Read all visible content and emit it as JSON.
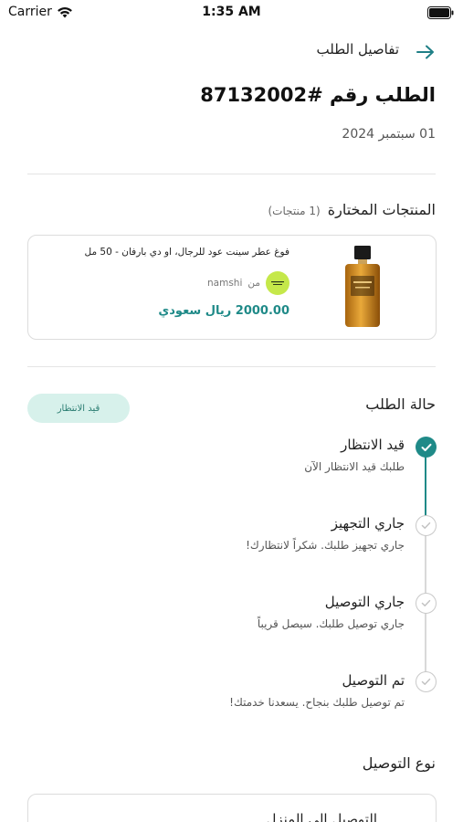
{
  "status_bar": {
    "carrier": "Carrier",
    "time": "1:35 AM"
  },
  "header": {
    "title": "تفاصيل الطلب",
    "back_icon": "arrow-right-icon"
  },
  "order": {
    "title": "الطلب رقم #87132002",
    "date": "01 سبتمبر 2024"
  },
  "products_section": {
    "title": "المنتجات المختارة",
    "count_label": "(1 منتجات)",
    "items": [
      {
        "name": "فوغ عطر سينت عود للرجال، او دي بارفان - 50 مل",
        "seller_from": "من",
        "seller_name": "namshi",
        "price": "2000.00 ريال سعودي"
      }
    ]
  },
  "status_section": {
    "title": "حالة الطلب",
    "badge": "قيد الانتظار",
    "steps": [
      {
        "title": "قيد الانتظار",
        "desc": "طلبك قيد الانتظار الآن",
        "state": "done"
      },
      {
        "title": "جاري التجهيز",
        "desc": "جاري تجهيز طلبك. شكراً لانتظارك!",
        "state": "todo"
      },
      {
        "title": "جاري التوصيل",
        "desc": "جاري توصيل طلبك. سيصل قريباً",
        "state": "todo"
      },
      {
        "title": "تم التوصيل",
        "desc": "تم توصيل طلبك بنجاح. يسعدنا خدمتك!",
        "state": "todo"
      }
    ]
  },
  "delivery_section": {
    "title": "نوع التوصيل",
    "value": "التوصيل إلى المنزل"
  },
  "colors": {
    "accent": "#1f8a88",
    "badge_bg": "#d7f1eb",
    "badge_text": "#2b7d72"
  }
}
